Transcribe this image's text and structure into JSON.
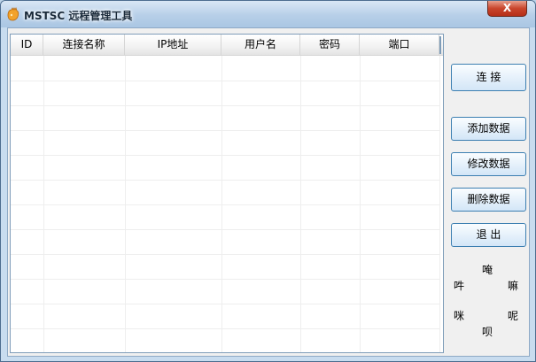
{
  "window": {
    "title": "MSTSC 远程管理工具",
    "close_label": "X"
  },
  "table": {
    "columns": [
      {
        "key": "id",
        "label": "ID"
      },
      {
        "key": "name",
        "label": "连接名称"
      },
      {
        "key": "ip",
        "label": "IP地址"
      },
      {
        "key": "user",
        "label": "用户名"
      },
      {
        "key": "password",
        "label": "密码"
      },
      {
        "key": "port",
        "label": "端口"
      }
    ],
    "rows": []
  },
  "buttons": {
    "connect": "连  接",
    "add": "添加数据",
    "edit": "修改数据",
    "delete": "删除数据",
    "exit": "退  出"
  },
  "decor": {
    "top": "唵",
    "left_upper": "吽",
    "right_upper": "嘛",
    "left_lower": "咪",
    "right_lower": "呢",
    "bottom": "呗"
  },
  "colors": {
    "accent": "#3c7fb1",
    "close": "#c9452c",
    "icon": "#f2a22a"
  }
}
